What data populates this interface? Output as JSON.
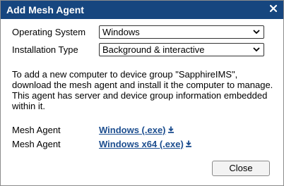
{
  "dialog": {
    "title": "Add Mesh Agent",
    "close_glyph": "✕"
  },
  "form": {
    "os_label": "Operating System",
    "os_value": "Windows",
    "install_label": "Installation Type",
    "install_value": "Background & interactive"
  },
  "description": "To add a new computer to device group \"SapphireIMS\", download the mesh agent and install it the computer to manage. This agent has server and device group information embedded within it.",
  "agents": [
    {
      "label": "Mesh Agent",
      "link": "Windows (.exe)"
    },
    {
      "label": "Mesh Agent",
      "link": "Windows x64 (.exe)"
    }
  ],
  "buttons": {
    "close": "Close"
  },
  "colors": {
    "titlebar": "#16467f",
    "link": "#1d4e8f"
  },
  "icons": [
    "close-icon",
    "chevron-down-icon",
    "download-icon"
  ]
}
